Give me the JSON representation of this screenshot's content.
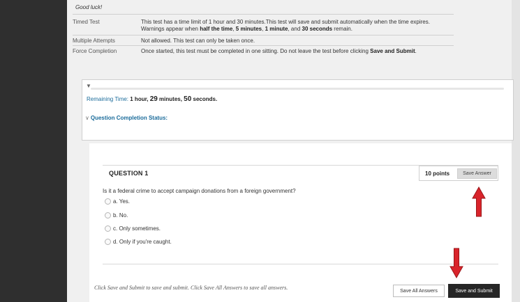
{
  "instructions": {
    "closing": "Good luck!",
    "rows": [
      {
        "label": "Timed Test",
        "line1_a": "This test has a time limit of 1 hour and 30 minutes.This test will save and submit automatically when the time expires.",
        "line2_a": "Warnings appear when ",
        "line2_b1": "half the time",
        "line2_sep1": ", ",
        "line2_b2": "5 minutes",
        "line2_sep2": ", ",
        "line2_b3": "1 minute",
        "line2_sep3": ", and ",
        "line2_b4": "30 seconds",
        "line2_end": " remain."
      },
      {
        "label": "Multiple Attempts",
        "text": "Not allowed. This test can only be taken once."
      },
      {
        "label": "Force Completion",
        "text_a": "Once started, this test must be completed in one sitting. Do not leave the test before clicking ",
        "text_b": "Save and Submit",
        "text_end": "."
      }
    ]
  },
  "timer": {
    "label": "Remaining Time:",
    "part1": " 1 hour, ",
    "minutes": "29",
    "part2": " minutes, ",
    "seconds": "50",
    "part3": " seconds.",
    "completion_status_label": "Question Completion Status:"
  },
  "question": {
    "title": "QUESTION 1",
    "points": "10 points",
    "save_answer_label": "Save Answer",
    "text": "Is it a federal crime to accept campaign donations from a foreign government?",
    "options": [
      "a. Yes.",
      "b. No.",
      "c. Only sometimes.",
      "d. Only if you're caught."
    ]
  },
  "footer": {
    "note": "Click Save and Submit to save and submit. Click Save All Answers to save all answers.",
    "save_all_label": "Save All Answers",
    "save_submit_label": "Save and Submit"
  },
  "colors": {
    "annotation_arrow": "#d9242b",
    "link_blue": "#1a6b9a",
    "primary_button": "#262626"
  },
  "icons": {
    "collapse": "triangle-down-icon",
    "radio": "radio-button-icon",
    "annotation": "red-arrow-icon"
  }
}
